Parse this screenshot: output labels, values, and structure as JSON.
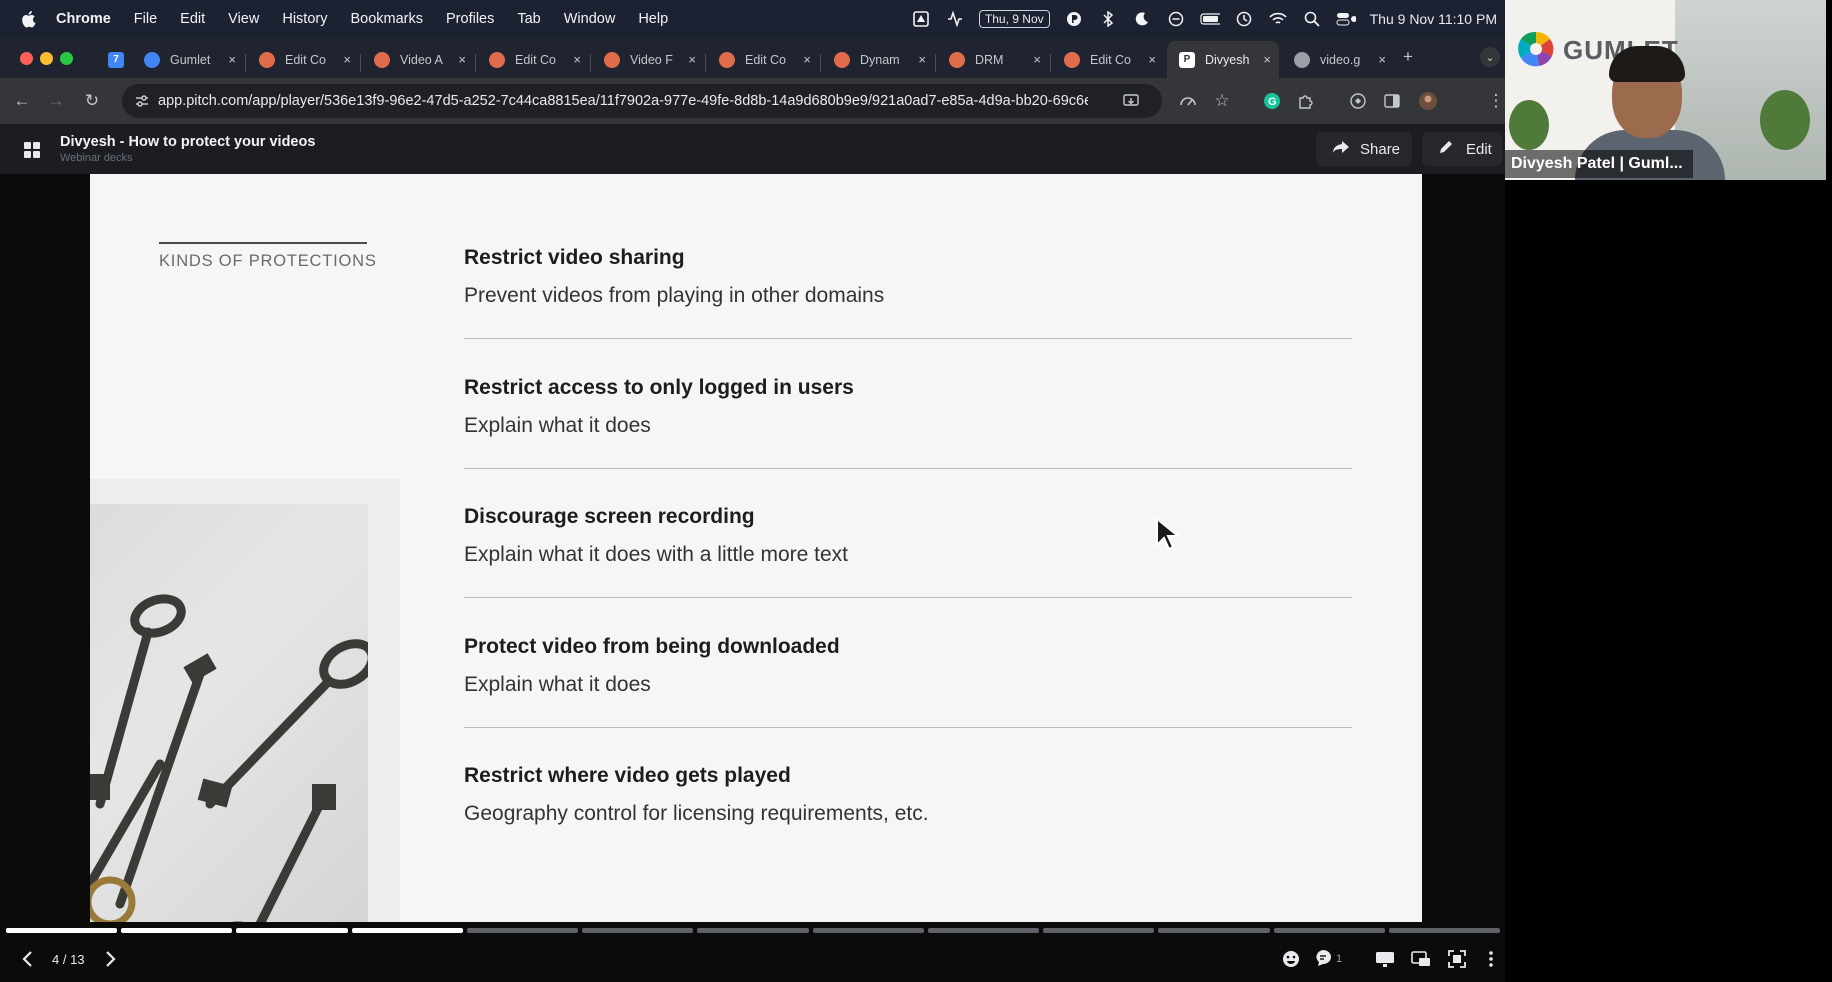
{
  "menubar": {
    "app": "Chrome",
    "items": [
      "File",
      "Edit",
      "View",
      "History",
      "Bookmarks",
      "Profiles",
      "Tab",
      "Window",
      "Help"
    ],
    "date_badge": "Thu, 9 Nov",
    "clock": "Thu 9 Nov  11:10 PM"
  },
  "tabs": [
    {
      "label": "Gumlet",
      "favicon": "gumlet-icon",
      "fav_color": "#4285f4"
    },
    {
      "label": "Edit Co",
      "favicon": "pitch-icon",
      "fav_color": "#e06c4b"
    },
    {
      "label": "Video A",
      "favicon": "pitch-icon",
      "fav_color": "#e06c4b"
    },
    {
      "label": "Edit Co",
      "favicon": "pitch-icon",
      "fav_color": "#e06c4b"
    },
    {
      "label": "Video F",
      "favicon": "pitch-icon",
      "fav_color": "#e06c4b"
    },
    {
      "label": "Edit Co",
      "favicon": "pitch-icon",
      "fav_color": "#e06c4b"
    },
    {
      "label": "Dynam",
      "favicon": "pitch-icon",
      "fav_color": "#e06c4b"
    },
    {
      "label": "DRM",
      "favicon": "pitch-icon",
      "fav_color": "#e06c4b"
    },
    {
      "label": "Edit Co",
      "favicon": "pitch-icon",
      "fav_color": "#e06c4b"
    },
    {
      "label": "Divyesh",
      "favicon": "pitch-p-icon",
      "fav_color": "#ffffff"
    },
    {
      "label": "video.g",
      "favicon": "globe-icon",
      "fav_color": "#9aa0a6"
    }
  ],
  "active_tab_index": 9,
  "addressbar": {
    "url": "app.pitch.com/app/player/536e13f9-96e2-47d5-a252-7c44ca8815ea/11f7902a-977e-49fe-8d8b-14a9d680b9e9/921a0ad7-e85a-4d9a-bb20-69c6e..."
  },
  "pitch": {
    "title": "Divyesh - How to protect your videos",
    "subtitle": "Webinar decks",
    "share_label": "Share",
    "edit_label": "Edit"
  },
  "slide": {
    "section_label": "KINDS OF PROTECTIONS",
    "items": [
      {
        "heading": "Restrict video sharing",
        "desc": "Prevent videos from playing in other domains"
      },
      {
        "heading": "Restrict access to only logged in users",
        "desc": "Explain what it does"
      },
      {
        "heading": "Discourage screen recording",
        "desc": "Explain what it does with a little more text"
      },
      {
        "heading": "Protect video from being downloaded",
        "desc": "Explain what it does"
      },
      {
        "heading": "Restrict where video gets played",
        "desc": "Geography control for licensing requirements, etc."
      }
    ]
  },
  "player": {
    "counter": "4 / 13",
    "current_slide": 4,
    "total_slides": 13,
    "comments_count": "1"
  },
  "webcam": {
    "brand_text": "GUMLET",
    "participant_name": "Divyesh Patel | Guml..."
  },
  "colors": {
    "progress_done": "#ffffff",
    "progress_todo": "#5f6368",
    "slide_bg": "#f5f6f8"
  }
}
